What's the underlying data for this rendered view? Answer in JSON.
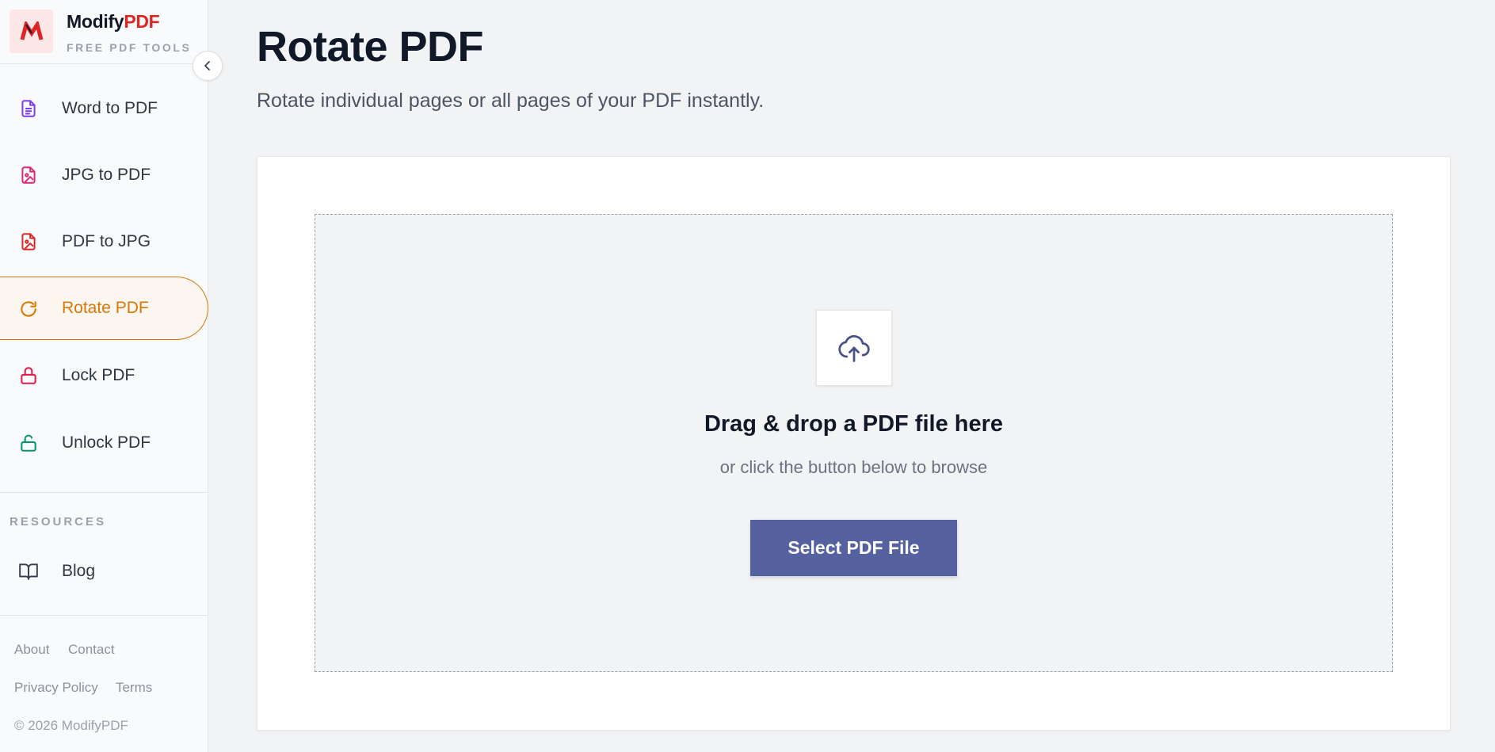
{
  "brand": {
    "name_main": "Modify",
    "name_accent": "PDF",
    "tagline": "FREE PDF TOOLS"
  },
  "sidebar": {
    "items": [
      {
        "label": "Word to PDF",
        "icon": "document-icon",
        "color": "#7c3aed"
      },
      {
        "label": "JPG to PDF",
        "icon": "image-file-icon",
        "color": "#db2777"
      },
      {
        "label": "PDF to JPG",
        "icon": "image-file-icon",
        "color": "#dc2626"
      },
      {
        "label": "Rotate PDF",
        "icon": "rotate-icon",
        "color": "#d97706",
        "active": true
      },
      {
        "label": "Lock PDF",
        "icon": "lock-icon",
        "color": "#e11d48"
      },
      {
        "label": "Unlock PDF",
        "icon": "unlock-icon",
        "color": "#059669"
      }
    ],
    "resources_label": "RESOURCES",
    "resources": [
      {
        "label": "Blog",
        "icon": "book-icon"
      }
    ],
    "footer_links": [
      "About",
      "Contact",
      "Privacy Policy",
      "Terms"
    ],
    "copyright": "© 2026 ModifyPDF"
  },
  "main": {
    "title": "Rotate PDF",
    "subtitle": "Rotate individual pages or all pages of your PDF instantly.",
    "dropzone": {
      "title": "Drag & drop a PDF file here",
      "subtitle": "or click the button below to browse",
      "button_label": "Select PDF File",
      "upload_icon": "cloud-upload-icon"
    }
  },
  "colors": {
    "accent_active": "#d97706",
    "button": "#5661a0",
    "brand_red": "#dc2626"
  }
}
